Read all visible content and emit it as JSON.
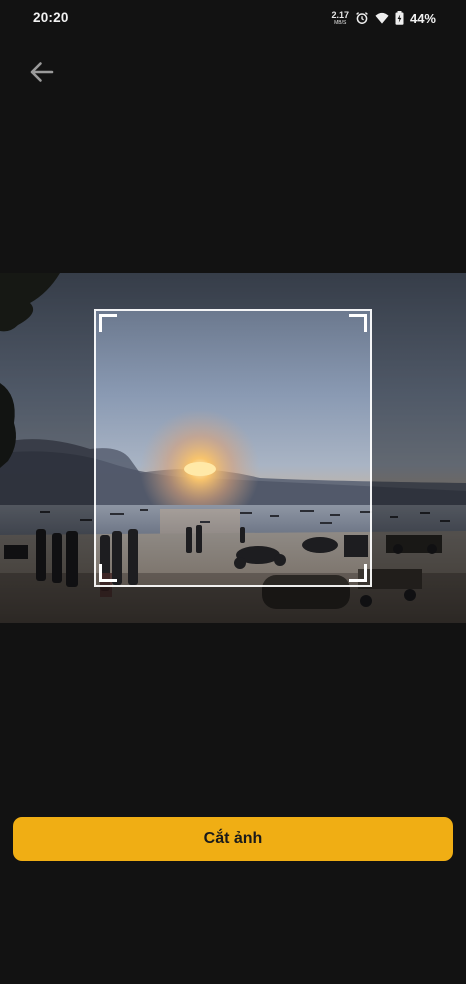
{
  "status_bar": {
    "time": "20:20",
    "net_speed_value": "2.17",
    "net_speed_unit": "MB/S",
    "battery_percent": "44%",
    "icons": [
      "alarm-icon",
      "wifi-icon",
      "battery-charging-icon"
    ]
  },
  "toolbar": {
    "back_icon": "arrow-left-icon"
  },
  "editor": {
    "image_content": "beach-sunset-photo",
    "crop_shape": "square"
  },
  "actions": {
    "crop_label": "Cắt ảnh"
  },
  "colors": {
    "background": "#121212",
    "accent": "#f0ae14",
    "button_text": "#1a1a1a"
  }
}
